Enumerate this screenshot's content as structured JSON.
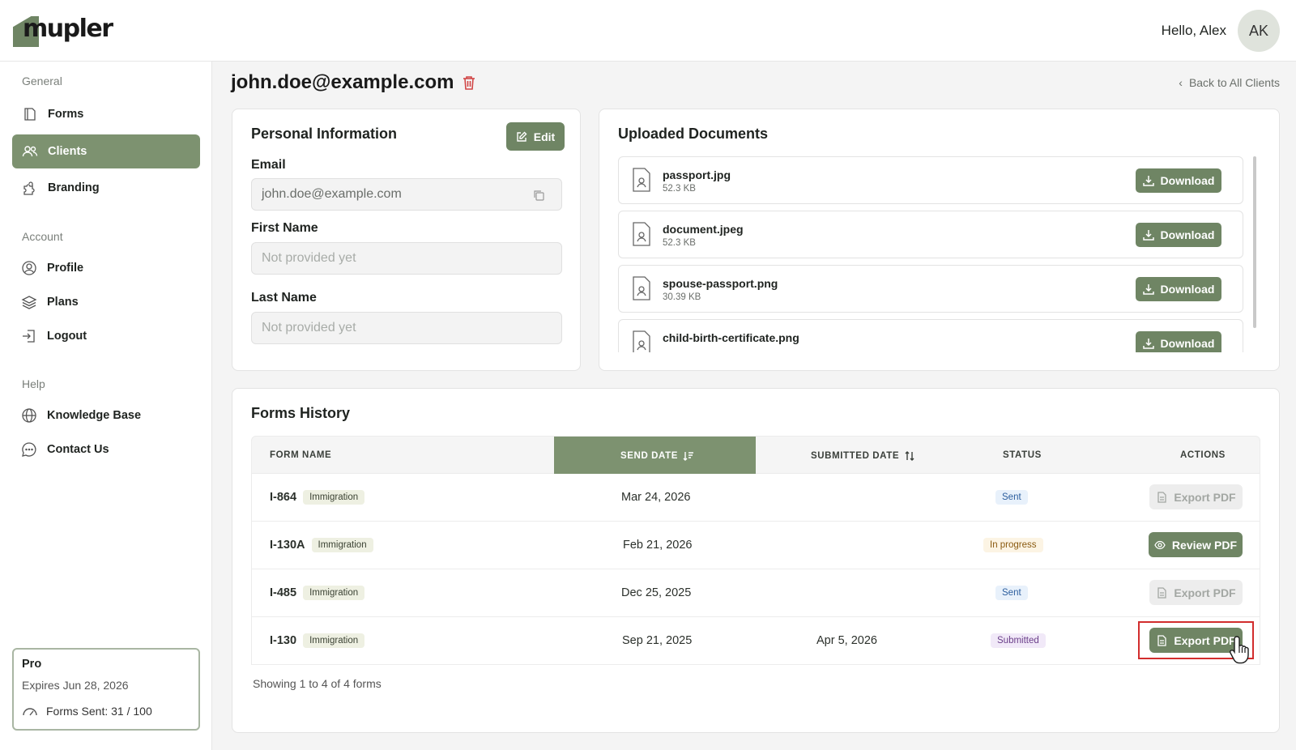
{
  "header": {
    "logo_text": "mupler",
    "greeting": "Hello, Alex",
    "avatar_initials": "AK"
  },
  "sidebar": {
    "general_title": "General",
    "general_items": [
      {
        "label": "Forms",
        "icon": "forms-icon"
      },
      {
        "label": "Clients",
        "icon": "clients-icon",
        "active": true
      },
      {
        "label": "Branding",
        "icon": "branding-icon"
      }
    ],
    "account_title": "Account",
    "account_items": [
      {
        "label": "Profile",
        "icon": "profile-icon"
      },
      {
        "label": "Plans",
        "icon": "plans-icon"
      },
      {
        "label": "Logout",
        "icon": "logout-icon"
      }
    ],
    "help_title": "Help",
    "help_items": [
      {
        "label": "Knowledge Base",
        "icon": "globe-icon"
      },
      {
        "label": "Contact Us",
        "icon": "chat-icon"
      }
    ],
    "plan": {
      "name": "Pro",
      "expires": "Expires Jun 28, 2026",
      "usage": "Forms Sent: 31 / 100"
    }
  },
  "page": {
    "title": "john.doe@example.com",
    "back_link": "Back to All Clients"
  },
  "personal_info": {
    "title": "Personal Information",
    "edit_label": "Edit",
    "email_label": "Email",
    "email_value": "john.doe@example.com",
    "first_name_label": "First Name",
    "first_name_placeholder": "Not provided yet",
    "last_name_label": "Last Name",
    "last_name_placeholder": "Not provided yet"
  },
  "documents": {
    "title": "Uploaded Documents",
    "download_label": "Download",
    "items": [
      {
        "name": "passport.jpg",
        "size": "52.3 KB"
      },
      {
        "name": "document.jpeg",
        "size": "52.3 KB"
      },
      {
        "name": "spouse-passport.png",
        "size": "30.39 KB"
      },
      {
        "name": "child-birth-certificate.png",
        "size": ""
      }
    ]
  },
  "forms_history": {
    "title": "Forms History",
    "columns": [
      "FORM NAME",
      "SEND DATE",
      "SUBMITTED DATE",
      "STATUS",
      "ACTIONS"
    ],
    "rows": [
      {
        "name": "I-864",
        "tag": "Immigration",
        "send_date": "Mar 24, 2026",
        "submitted_date": "",
        "status": "Sent",
        "action": "Export PDF"
      },
      {
        "name": "I-130A",
        "tag": "Immigration",
        "send_date": "Feb 21, 2026",
        "submitted_date": "",
        "status": "In progress",
        "action": "Review PDF"
      },
      {
        "name": "I-485",
        "tag": "Immigration",
        "send_date": "Dec 25, 2025",
        "submitted_date": "",
        "status": "Sent",
        "action": "Export PDF"
      },
      {
        "name": "I-130",
        "tag": "Immigration",
        "send_date": "Sep 21, 2025",
        "submitted_date": "Apr 5, 2026",
        "status": "Submitted",
        "action": "Export PDF"
      }
    ],
    "footer": "Showing 1 to 4 of 4 forms"
  },
  "colors": {
    "accent": "#6f8564",
    "active_nav": "#7d9270",
    "highlight": "#d22d2d"
  }
}
